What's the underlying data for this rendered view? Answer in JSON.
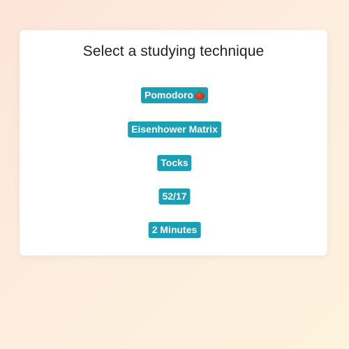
{
  "card": {
    "title": "Select a studying technique"
  },
  "techniques": [
    {
      "label": "Pomodoro",
      "icon": "tomato-icon"
    },
    {
      "label": "Eisenhower Matrix"
    },
    {
      "label": "Tocks"
    },
    {
      "label": "52/17"
    },
    {
      "label": "2 Minutes"
    }
  ],
  "colors": {
    "accent": "#1a9fb5",
    "card_bg": "#ffffff",
    "title_text": "#222222"
  }
}
